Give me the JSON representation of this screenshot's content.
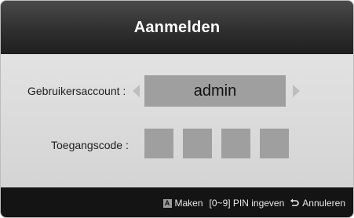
{
  "dialog": {
    "title": "Aanmelden"
  },
  "account": {
    "label": "Gebruikersaccount :",
    "value": "admin"
  },
  "passcode": {
    "label": "Toegangscode :",
    "digits": [
      "",
      "",
      "",
      ""
    ]
  },
  "footer": {
    "key_a": "A",
    "make_label": "Maken",
    "pin_label": "[0~9] PIN ingeven",
    "cancel_label": "Annuleren"
  },
  "colors": {
    "header": "#2f2f2f",
    "body": "#d9d9d9",
    "field": "#9f9f9f",
    "footer": "#141414"
  }
}
